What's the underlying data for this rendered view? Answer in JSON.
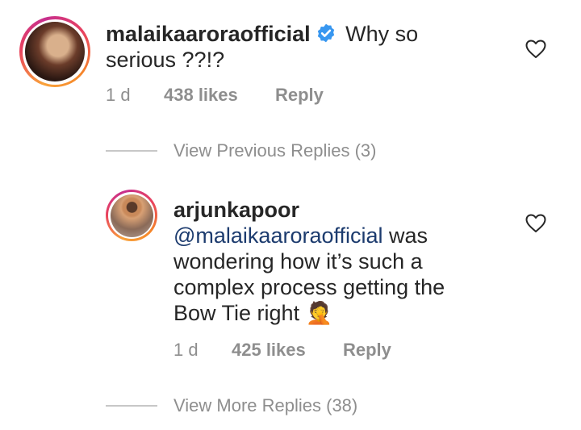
{
  "comment": {
    "username": "malaikaaroraofficial",
    "text": "Why so serious ??!?",
    "time": "1 d",
    "likes": "438 likes",
    "reply_label": "Reply",
    "verified": true
  },
  "previous_replies": "View Previous Replies (3)",
  "reply": {
    "username": "arjunkapoor",
    "mention": "@malaikaaroraofficial",
    "text_after_mention": " was wondering how it’s such a complex process getting the Bow Tie right ",
    "emoji": "🤦",
    "time": "1 d",
    "likes": "425 likes",
    "reply_label": "Reply"
  },
  "more_replies": "View More Replies (38)",
  "icons": {
    "verified": "verified-badge-icon",
    "like": "heart-outline-icon"
  },
  "colors": {
    "verified_blue": "#3897f0",
    "mention": "#1c3b6e",
    "meta_gray": "#8e8e8e"
  }
}
